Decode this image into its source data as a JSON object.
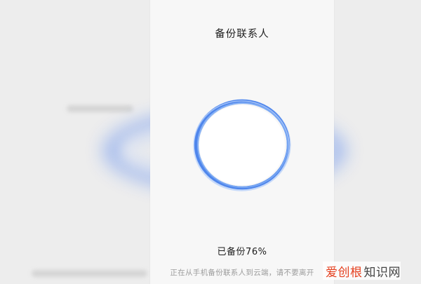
{
  "header": {
    "title": "备份联系人"
  },
  "progress": {
    "percent": 76,
    "status_text": "已备份76%",
    "hint_text": "正在从手机备份联系人到云端，请不要离开",
    "ring_color": "#4f86ec",
    "ring_color_light": "#8db4f6"
  },
  "watermark": {
    "brand_accent": "爱创根",
    "brand_rest": "知识网",
    "accent_color": "#e5401f"
  },
  "icons": [
    "progress-ring-icon"
  ]
}
